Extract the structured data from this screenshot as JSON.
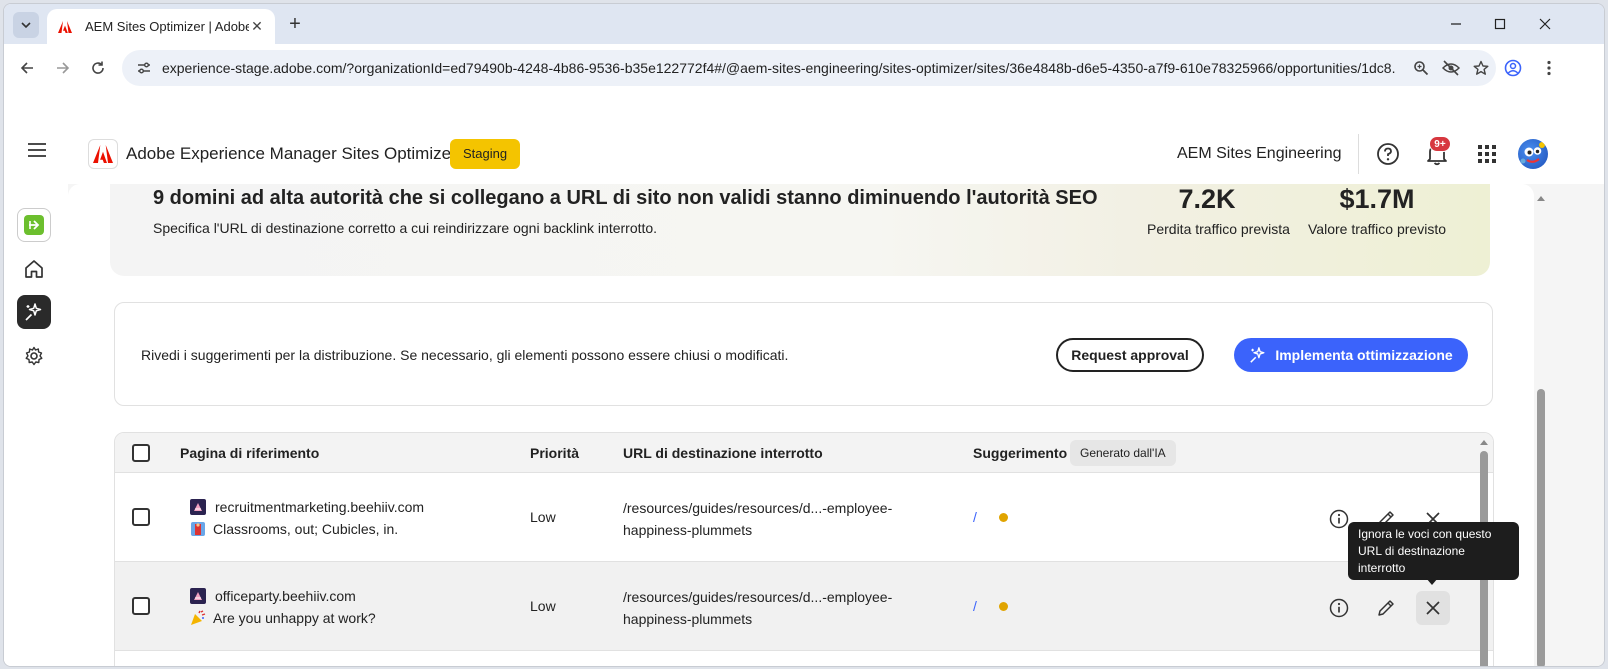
{
  "browser": {
    "tab_title": "AEM Sites Optimizer | Adobe Ex",
    "url": "experience-stage.adobe.com/?organizationId=ed79490b-4248-4b86-9536-b35e122772f4#/@aem-sites-engineering/sites-optimizer/sites/36e4848b-d6e5-4350-a7f9-610e78325966/opportunities/1dc8..."
  },
  "header": {
    "app_title": "Adobe Experience Manager Sites Optimizer",
    "env_badge": "Staging",
    "org_name": "AEM Sites Engineering",
    "notification_count": "9+"
  },
  "hero": {
    "title": "9 domini ad alta autorità che si collegano a URL di sito non validi stanno diminuendo l'autorità SEO",
    "description": "Specifica l'URL di destinazione corretto a cui reindirizzare ogni backlink interrotto.",
    "metrics": [
      {
        "value": "7.2K",
        "label": "Perdita traffico prevista"
      },
      {
        "value": "$1.7M",
        "label": "Valore traffico previsto"
      }
    ]
  },
  "review": {
    "text": "Rivedi i suggerimenti per la distribuzione. Se necessario, gli elementi possono essere chiusi o modificati.",
    "request_label": "Request approval",
    "deploy_label": "Implementa ottimizzazione"
  },
  "table": {
    "headers": {
      "referring_page": "Pagina di riferimento",
      "priority": "Priorità",
      "broken_url": "URL di destinazione interrotto",
      "suggestion": "Suggerimento",
      "ai_badge": "Generato dall'IA"
    },
    "rows": [
      {
        "site": "recruitmentmarketing.beehiiv.com",
        "title": "Classrooms, out; Cubicles, in.",
        "priority": "Low",
        "broken_url_line1": "/resources/guides/resources/d...-employee-",
        "broken_url_line2": "happiness-plummets",
        "suggestion": "/"
      },
      {
        "site": "officeparty.beehiiv.com",
        "title": "Are you unhappy at work?",
        "priority": "Low",
        "broken_url_line1": "/resources/guides/resources/d...-employee-",
        "broken_url_line2": "happiness-plummets",
        "suggestion": "/"
      }
    ]
  },
  "tooltip": {
    "text": "Ignora le voci con questo URL di destinazione interrotto"
  },
  "colors": {
    "accent": "#3b63fb",
    "staging": "#f4c400",
    "adobe_red": "#eb1000",
    "status_dot": "#e0a400"
  }
}
